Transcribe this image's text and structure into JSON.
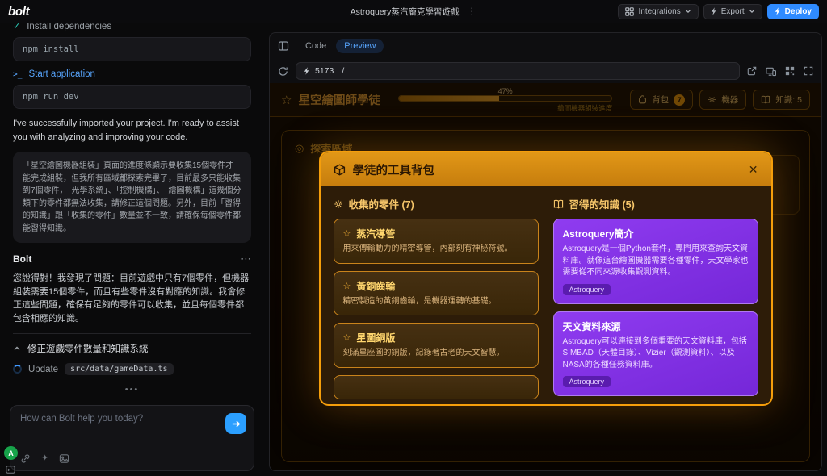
{
  "icons": {
    "vertical_dots": "⋮",
    "ellipsis": "⋯",
    "check": "✓",
    "star": "☆",
    "target": "◎",
    "close": "✕",
    "sparkle": "✦",
    "prompt": ">_",
    "stream_dots": "•••"
  },
  "topbar": {
    "logo": "bolt",
    "title": "Astroquery蒸汽龐克學習遊戲",
    "integrations": "Integrations",
    "export": "Export",
    "deploy": "Deploy"
  },
  "chat": {
    "step_install": {
      "label": "Install dependencies",
      "command": "npm install"
    },
    "step_start": {
      "label": "Start application",
      "command": "npm run dev"
    },
    "intro": "I've successfully imported your project. I'm ready to assist you with analyzing and improving your code.",
    "user_message": "「星空繪圖機器組裝」頁面的進度條顯示要收集15個零件才能完成組裝，但我所有區域都探索完畢了，目前最多只能收集到7個零件，「光學系統」、「控制機構」、「繪圖機構」這幾個分類下的零件都無法收集，請修正這個問題。另外，目前「習得的知識」跟「收集的零件」數量並不一致，請確保每個零件都能習得知識。",
    "assistant_name": "Bolt",
    "assistant_message": "您說得對！我發現了問題：目前遊戲中只有7個零件，但機器組裝需要15個零件，而且有些零件沒有對應的知識。我會修正這些問題，確保有足夠的零件可以收集，並且每個零件都包含相應的知識。",
    "artifact_title": "修正遊戲零件數量和知識系統",
    "update_label": "Update",
    "update_file": "src/data/gameData.ts",
    "input_placeholder": "How can Bolt help you today?",
    "avatar_letter": "A"
  },
  "workbench": {
    "tab_code": "Code",
    "tab_preview": "Preview",
    "port": "5173",
    "path": "/"
  },
  "game": {
    "title": "星空繪圖師學徒",
    "progress_percent": "47%",
    "progress_label": "繪圖機器組裝進度",
    "btn_backpack": "背包",
    "backpack_count": "7",
    "btn_machine": "機器",
    "btn_knowledge": "知識: 5",
    "explore_title": "探索區域",
    "modal": {
      "title": "學徒的工具背包",
      "parts_header": "收集的零件 (7)",
      "knowledge_header": "習得的知識 (5)",
      "parts": [
        {
          "name": "蒸汽導管",
          "desc": "用來傳輸動力的精密導管，內部刻有神秘符號。"
        },
        {
          "name": "黃銅齒輪",
          "desc": "精密製造的黃銅齒輪，是機器運轉的基礎。"
        },
        {
          "name": "星圖銅版",
          "desc": "刻滿星座圖的銅版，記錄著古老的天文智慧。"
        }
      ],
      "knowledge": [
        {
          "title": "Astroquery簡介",
          "desc": "Astroquery是一個Python套件，專門用來查詢天文資料庫。就像這台繪圖機器需要各種零件，天文學家也需要從不同來源收集觀測資料。",
          "tag": "Astroquery"
        },
        {
          "title": "天文資料來源",
          "desc": "Astroquery可以連接到多個重要的天文資料庫，包括SIMBAD（天體目錄）、Vizier（觀測資料）、以及NASA的各種任務資料庫。",
          "tag": "Astroquery"
        }
      ]
    }
  }
}
